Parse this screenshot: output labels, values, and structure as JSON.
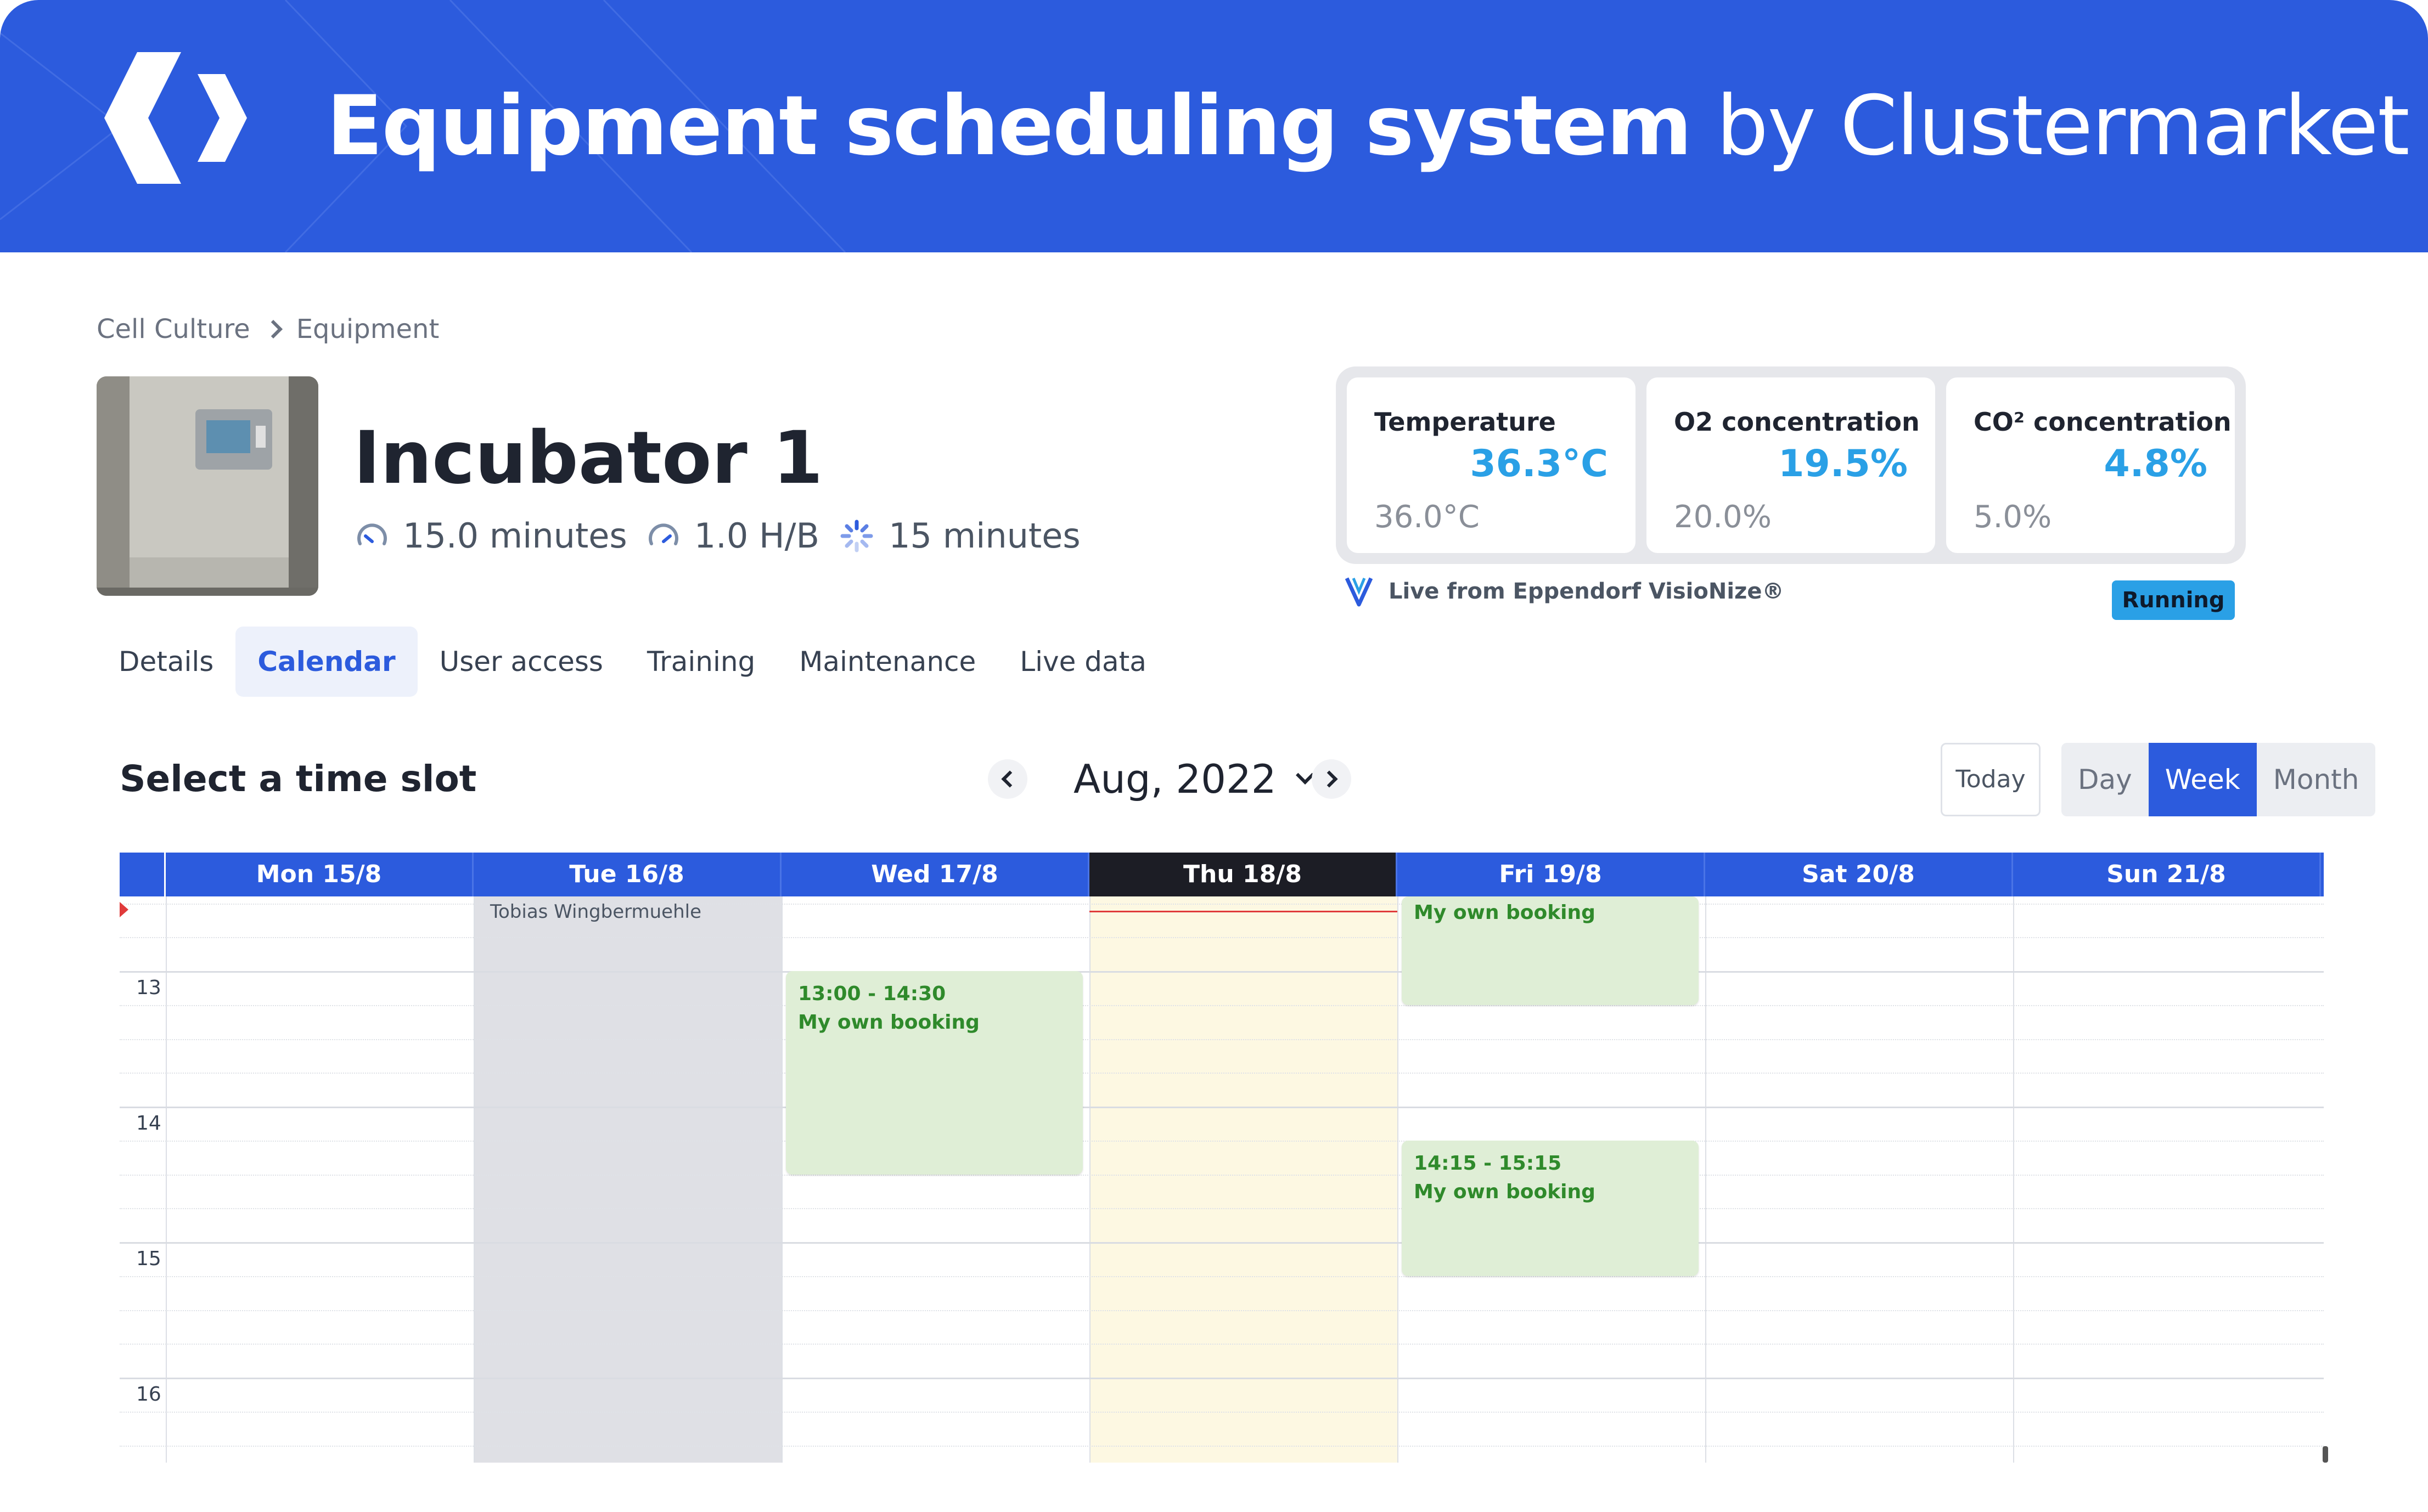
{
  "banner": {
    "title_strong": "Equipment scheduling system",
    "title_light": "by Clustermarket",
    "logo_icon": "clustermarket-logo-icon"
  },
  "breadcrumb": [
    "Cell Culture",
    "Equipment"
  ],
  "equipment": {
    "name": "Incubator 1",
    "metrics": [
      {
        "icon": "gauge-icon",
        "value": "15.0 minutes"
      },
      {
        "icon": "gauge-icon",
        "value": "1.0 H/B"
      },
      {
        "icon": "loading-spinner-icon",
        "value": "15 minutes"
      }
    ]
  },
  "tabs": [
    "Details",
    "Calendar",
    "User access",
    "Training",
    "Maintenance",
    "Live data"
  ],
  "active_tab": "Calendar",
  "live_data": {
    "cells": [
      {
        "label": "Temperature",
        "value": "36.3°C",
        "target": "36.0°C"
      },
      {
        "label": "O2 concentration",
        "value": "19.5%",
        "target": "20.0%"
      },
      {
        "label": "CO² concentration",
        "value": "4.8%",
        "target": "5.0%"
      }
    ],
    "source": "Live from Eppendorf VisioNize®",
    "status": "Running"
  },
  "calendar": {
    "title": "Select a time slot",
    "month": "Aug, 2022",
    "today_label": "Today",
    "views": [
      "Day",
      "Week",
      "Month"
    ],
    "active_view": "Week",
    "days": [
      "Mon 15/8",
      "Tue 16/8",
      "Wed 17/8",
      "Thu 18/8",
      "Fri 19/8",
      "Sat 20/8",
      "Sun 21/8"
    ],
    "today_index": 3,
    "hours": [
      "13",
      "14",
      "15",
      "16"
    ],
    "blocked": {
      "day_index": 1,
      "owner": "Tobias Wingbermuehle"
    },
    "events": [
      {
        "day_index": 2,
        "start": "13:00",
        "end": "14:30",
        "time": "13:00 - 14:30",
        "title": "My own booking"
      },
      {
        "day_index": 4,
        "start": "12:00",
        "end": "13:15",
        "time": "",
        "title": "My own booking"
      },
      {
        "day_index": 4,
        "start": "14:15",
        "end": "15:15",
        "time": "14:15 - 15:15",
        "title": "My own booking"
      }
    ]
  },
  "colors": {
    "brand": "#2c5bdd",
    "live_value": "#2aa0e6",
    "event_bg": "#dfeed6",
    "event_text": "#2f8a2b",
    "today_column": "#fdf8e2",
    "now_line": "#e03b3b"
  }
}
